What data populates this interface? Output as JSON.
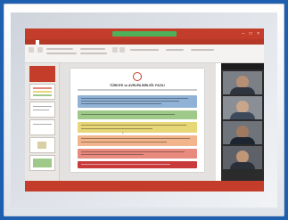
{
  "app": {
    "doc_title": "",
    "tabs": [
      "",
      "",
      "",
      "",
      "",
      "",
      "",
      ""
    ]
  },
  "slide": {
    "title": "TÜRKİYE ve AVRUPA BİRLİĞİ: FAZIL!",
    "band_colors": [
      "#8fb2d6",
      "#9fc989",
      "#e8d777",
      "#f2b48a",
      "#e88a7d",
      "#c93a3a"
    ]
  },
  "video_call": {
    "participants": 4
  },
  "colors": {
    "background": "#1f5fb0",
    "accent": "#c43d2a",
    "status_green": "#4fb05a"
  }
}
